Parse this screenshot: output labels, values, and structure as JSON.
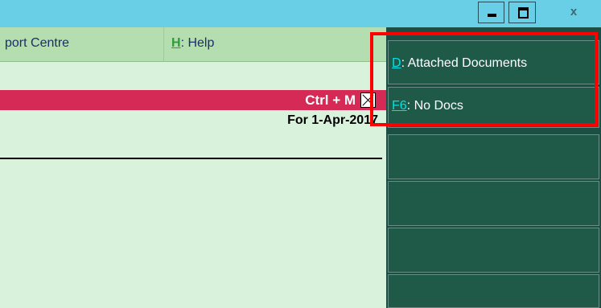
{
  "window": {
    "minimize_label": "",
    "maximize_label": "",
    "close_label": "x"
  },
  "menubar": {
    "support_label": "port Centre",
    "help_hotkey": "H",
    "help_label": ": Help"
  },
  "header": {
    "shortcut": "Ctrl + M",
    "period": "For 1-Apr-2017"
  },
  "right_panel": {
    "buttons": [
      {
        "hotkey": "D",
        "label": ": Attached Documents"
      },
      {
        "hotkey": "F6",
        "label": ": No Docs"
      },
      {
        "hotkey": "",
        "label": ""
      },
      {
        "hotkey": "",
        "label": ""
      },
      {
        "hotkey": "",
        "label": ""
      },
      {
        "hotkey": "",
        "label": ""
      }
    ]
  },
  "colors": {
    "titlebar": "#69cfe6",
    "main_bg": "#d9f2db",
    "menubar": "#b4deb0",
    "red_bar": "#d42a55",
    "panel": "#1c4f43",
    "hotkey_cyan": "#00e0e8",
    "highlight": "#ff0000"
  },
  "icons": [
    "minimize-icon",
    "maximize-icon",
    "close-icon",
    "close-x-icon"
  ]
}
